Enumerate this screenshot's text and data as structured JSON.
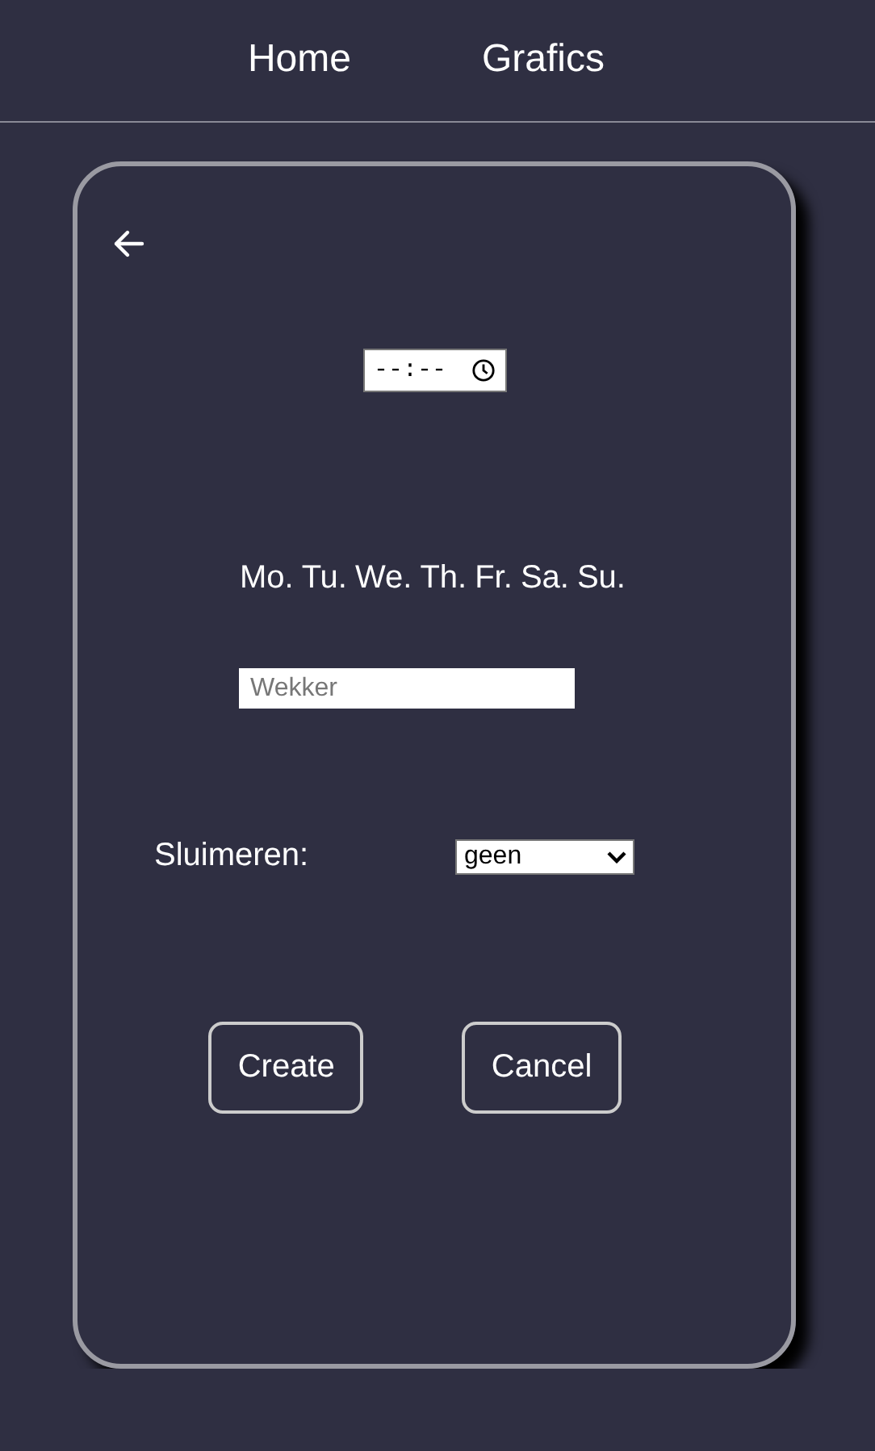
{
  "nav": [
    {
      "label": "Home"
    },
    {
      "label": "Grafics"
    }
  ],
  "time_field": {
    "placeholder": "--:--"
  },
  "days": [
    "Mo.",
    "Tu.",
    "We.",
    "Th.",
    "Fr.",
    "Sa.",
    "Su."
  ],
  "name_field": {
    "placeholder": "Wekker"
  },
  "snooze": {
    "label": "Sluimeren:",
    "value": "geen"
  },
  "buttons": [
    {
      "label": "Create"
    },
    {
      "label": "Cancel"
    }
  ]
}
